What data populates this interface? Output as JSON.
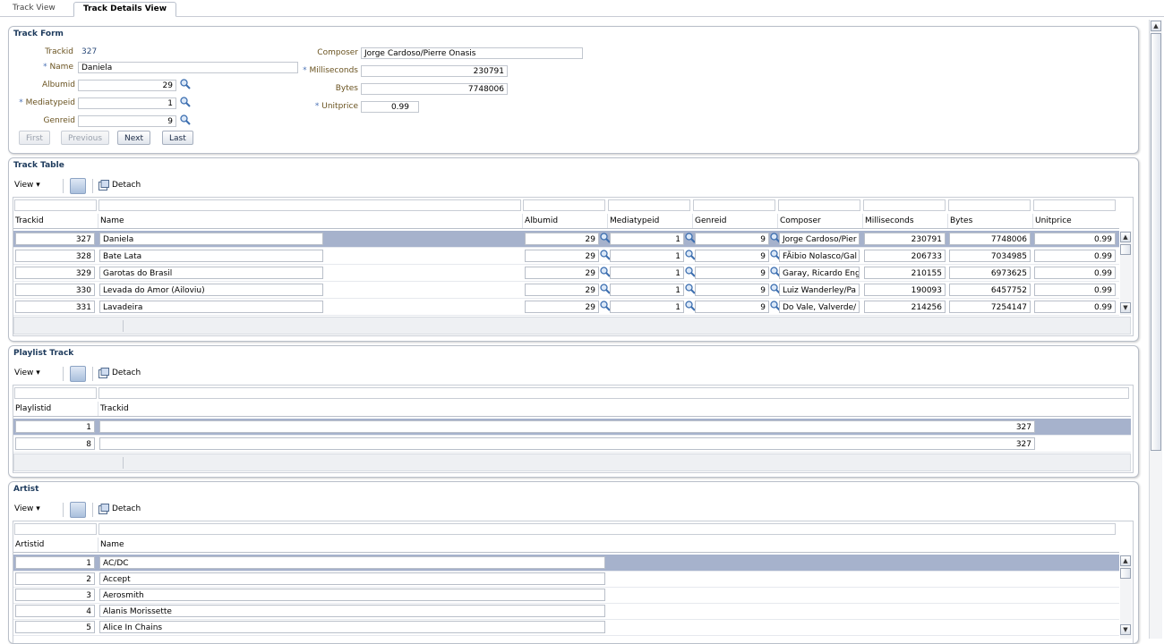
{
  "tabs": [
    "Track View",
    "Track Details View"
  ],
  "track_form": {
    "title": "Track Form",
    "trackid_label": "Trackid",
    "trackid_value": "327",
    "name_label": "* Name",
    "name_value": "Daniela",
    "albumid_label": "Albumid",
    "albumid_value": "29",
    "mediatypeid_label": "* Mediatypeid",
    "mediatypeid_value": "1",
    "genreid_label": "Genreid",
    "genreid_value": "9",
    "composer_label": "Composer",
    "composer_value": "Jorge Cardoso/Pierre Onasis",
    "milliseconds_label": "* Milliseconds",
    "milliseconds_value": "230791",
    "bytes_label": "Bytes",
    "bytes_value": "7748006",
    "unitprice_label": "* Unitprice",
    "unitprice_value": "0.99",
    "buttons": {
      "first": "First",
      "previous": "Previous",
      "next": "Next",
      "last": "Last"
    }
  },
  "track_table": {
    "title": "Track Table",
    "view_label": "View ▾",
    "detach_label": "Detach",
    "headers": [
      "Trackid",
      "Name",
      "Albumid",
      "Mediatypeid",
      "Genreid",
      "Composer",
      "Milliseconds",
      "Bytes",
      "Unitprice"
    ],
    "rows": [
      [
        "327",
        "Daniela",
        "29",
        "1",
        "9",
        "Jorge Cardoso/Pier",
        "230791",
        "7748006",
        "0.99"
      ],
      [
        "328",
        "Bate Lata",
        "29",
        "1",
        "9",
        "FÃibio Nolasco/Gal",
        "206733",
        "7034985",
        "0.99"
      ],
      [
        "329",
        "Garotas do Brasil",
        "29",
        "1",
        "9",
        "Garay, Ricardo Eng",
        "210155",
        "6973625",
        "0.99"
      ],
      [
        "330",
        "Levada do Amor (Ailoviu)",
        "29",
        "1",
        "9",
        "Luiz Wanderley/Pa",
        "190093",
        "6457752",
        "0.99"
      ],
      [
        "331",
        "Lavadeira",
        "29",
        "1",
        "9",
        "Do Vale, Valverde/",
        "214256",
        "7254147",
        "0.99"
      ]
    ]
  },
  "playlist_track": {
    "title": "Playlist Track",
    "view_label": "View ▾",
    "detach_label": "Detach",
    "headers": [
      "Playlistid",
      "Trackid"
    ],
    "rows": [
      [
        "1",
        "327"
      ],
      [
        "8",
        "327"
      ]
    ]
  },
  "artist": {
    "title": "Artist",
    "view_label": "View ▾",
    "detach_label": "Detach",
    "headers": [
      "Artistid",
      "Name"
    ],
    "rows": [
      [
        "1",
        "AC/DC"
      ],
      [
        "2",
        "Accept"
      ],
      [
        "3",
        "Aerosmith"
      ],
      [
        "4",
        "Alanis Morissette"
      ],
      [
        "5",
        "Alice In Chains"
      ]
    ]
  },
  "colors": {
    "selected_row": "#a6b2cc",
    "title": "#1d3a5c",
    "label": "#6a5320",
    "required": "#4b72b5"
  },
  "icons": [
    "search-icon",
    "query-by-example-icon",
    "detach-icon",
    "scroll-up-icon",
    "scroll-down-icon"
  ]
}
